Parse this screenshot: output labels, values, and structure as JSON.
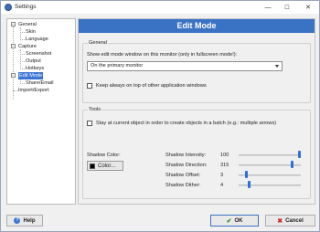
{
  "window": {
    "title": "Settings",
    "controls": {
      "minimize": "—",
      "maximize": "☐",
      "close": "✕"
    }
  },
  "tree": {
    "items": [
      {
        "label": "General",
        "toggle": "−"
      },
      {
        "label": "Skin"
      },
      {
        "label": "Language"
      },
      {
        "label": "Capture",
        "toggle": "−"
      },
      {
        "label": "Screenshot"
      },
      {
        "label": "Output"
      },
      {
        "label": "Hotkeys"
      },
      {
        "label": "Edit Mode",
        "toggle": "−",
        "selected": true
      },
      {
        "label": "Share/Email"
      },
      {
        "label": "Import/Export"
      }
    ]
  },
  "panel": {
    "header": "Edit Mode",
    "general": {
      "legend": "General",
      "monitor_label": "Show edit mode window on this monitor (only in fullscreen mode!):",
      "monitor_value": "On the primary monitor",
      "always_on_top": "Keep always on top of other application windows"
    },
    "tools": {
      "legend": "Tools",
      "stay_on_object": "Stay at current object in order to create objects in a batch (e.g.: multiple arrows)",
      "shadow_color_label": "Shadow Color:",
      "color_button": "Color...",
      "shadow_color": "#000000",
      "sliders": [
        {
          "label": "Shadow Intensity:",
          "value": "100",
          "fraction": 1.0
        },
        {
          "label": "Shadow Direction:",
          "value": "315",
          "fraction": 0.875
        },
        {
          "label": "Shadow Offset:",
          "value": "3",
          "fraction": 0.1
        },
        {
          "label": "Shadow Dither:",
          "value": "4",
          "fraction": 0.15
        }
      ]
    }
  },
  "footer": {
    "help": "Help",
    "ok": "OK",
    "cancel": "Cancel"
  },
  "colors": {
    "accent": "#3a72c4",
    "selection": "#3c74d6"
  }
}
